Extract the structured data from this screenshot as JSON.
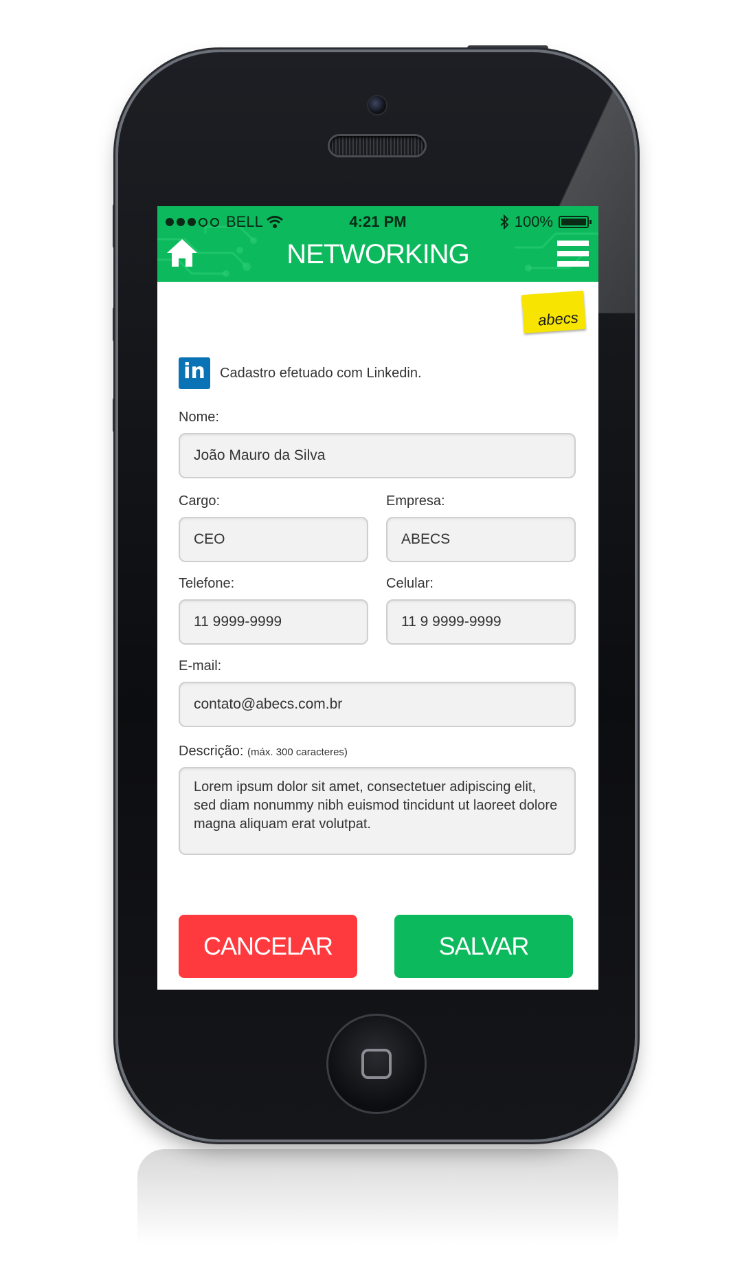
{
  "status_bar": {
    "carrier": "BELL",
    "time": "4:21 PM",
    "battery": "100%"
  },
  "header": {
    "title": "NETWORKING",
    "home_icon": "home-icon",
    "menu_icon": "hamburger-menu-icon",
    "color": "#0cb95c"
  },
  "logo": {
    "text": "abecs",
    "color": "#f7e400"
  },
  "linkedin": {
    "badge": "in",
    "text": "Cadastro efetuado com Linkedin."
  },
  "form": {
    "nome": {
      "label": "Nome:",
      "value": "João Mauro da Silva"
    },
    "cargo": {
      "label": "Cargo:",
      "value": "CEO"
    },
    "empresa": {
      "label": "Empresa:",
      "value": "ABECS"
    },
    "telefone": {
      "label": "Telefone:",
      "value": "11 9999-9999"
    },
    "celular": {
      "label": "Celular:",
      "value": "11 9 9999-9999"
    },
    "email": {
      "label": "E-mail:",
      "value": "contato@abecs.com.br"
    },
    "descricao": {
      "label": "Descrição:",
      "hint": "(máx. 300 caracteres)",
      "value": "Lorem ipsum dolor sit amet, consectetuer adipiscing elit, sed diam nonummy nibh euismod tincidunt ut laoreet dolore magna aliquam erat volutpat."
    }
  },
  "buttons": {
    "cancel": {
      "label": "CANCELAR",
      "color": "#ff3a3f"
    },
    "save": {
      "label": "SALVAR",
      "color": "#0cb95c"
    }
  }
}
